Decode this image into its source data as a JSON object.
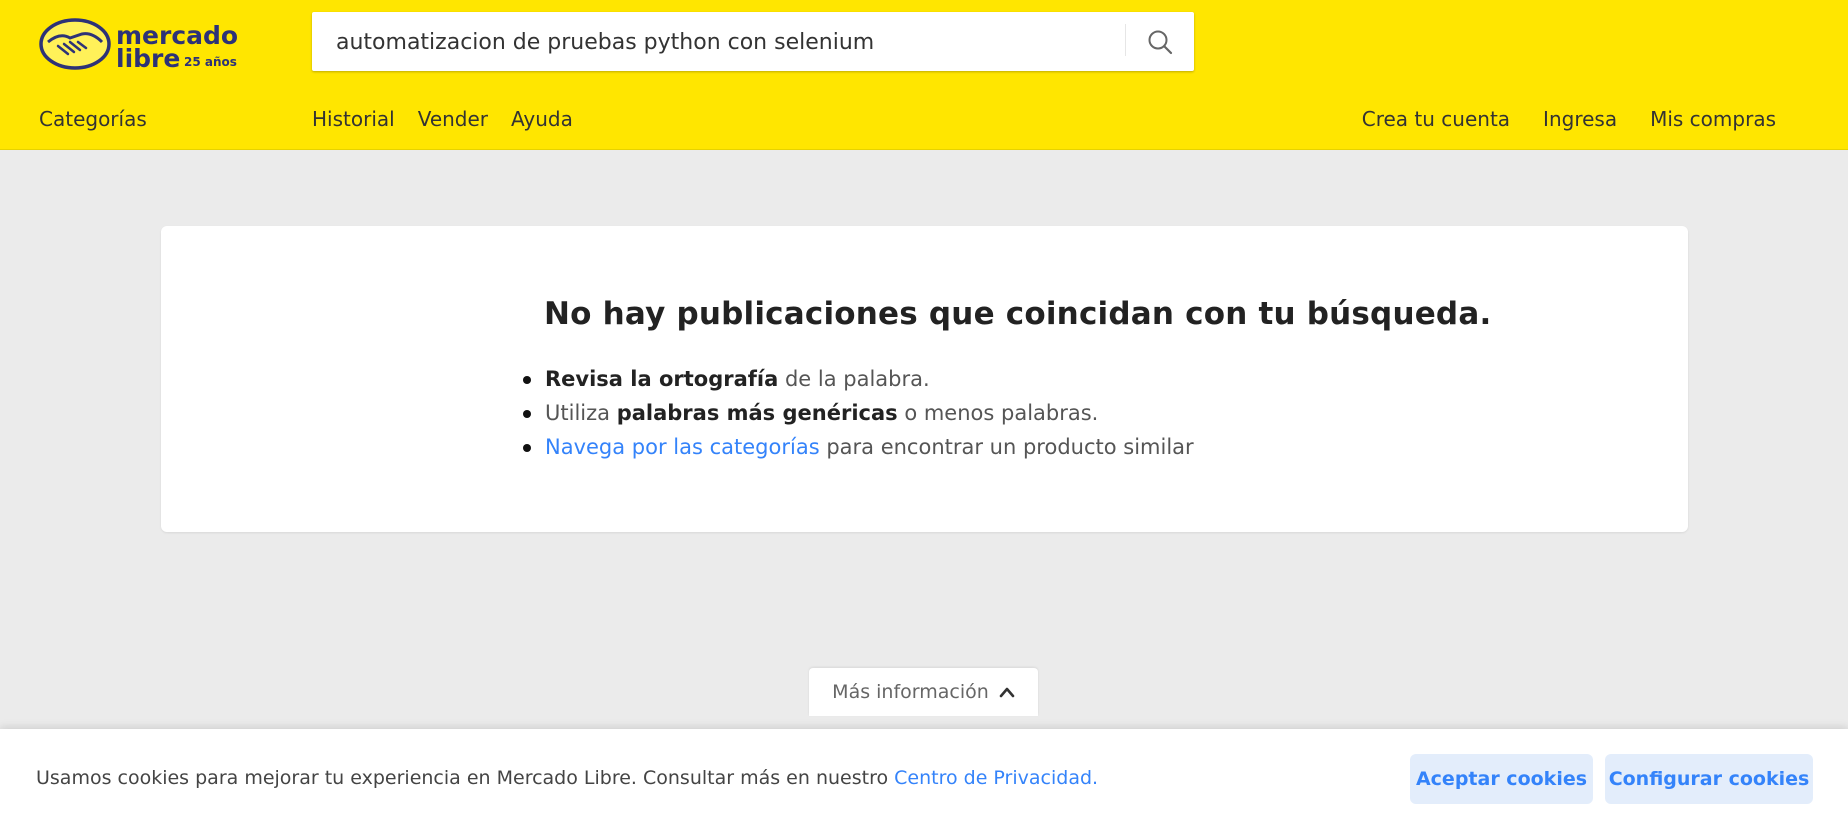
{
  "header": {
    "logo": {
      "line1": "mercado",
      "line2": "libre",
      "badge": "25 años"
    },
    "search": {
      "value": "automatizacion de pruebas python con selenium",
      "icon": "search-icon"
    },
    "nav_left": "Categorías",
    "nav_mid": [
      "Historial",
      "Vender",
      "Ayuda"
    ],
    "nav_right": [
      "Crea tu cuenta",
      "Ingresa",
      "Mis compras"
    ]
  },
  "result": {
    "title": "No hay publicaciones que coincidan con tu búsqueda.",
    "tip1": {
      "bold": "Revisa la ortografía",
      "rest": " de la palabra."
    },
    "tip2": {
      "pre": "Utiliza ",
      "bold": "palabras más genéricas",
      "rest": " o menos palabras."
    },
    "tip3": {
      "link": "Navega por las categorías",
      "rest": " para encontrar un producto similar"
    }
  },
  "more_info": {
    "label": "Más información",
    "icon": "chevron-up-icon"
  },
  "cookies": {
    "text": "Usamos cookies para mejorar tu experiencia en Mercado Libre. Consultar más en nuestro ",
    "link": "Centro de Privacidad.",
    "accept": "Aceptar cookies",
    "configure": "Configurar cookies"
  },
  "colors": {
    "brand_yellow": "#ffe600",
    "link_blue": "#3483fa",
    "logo_navy": "#2d3277"
  }
}
